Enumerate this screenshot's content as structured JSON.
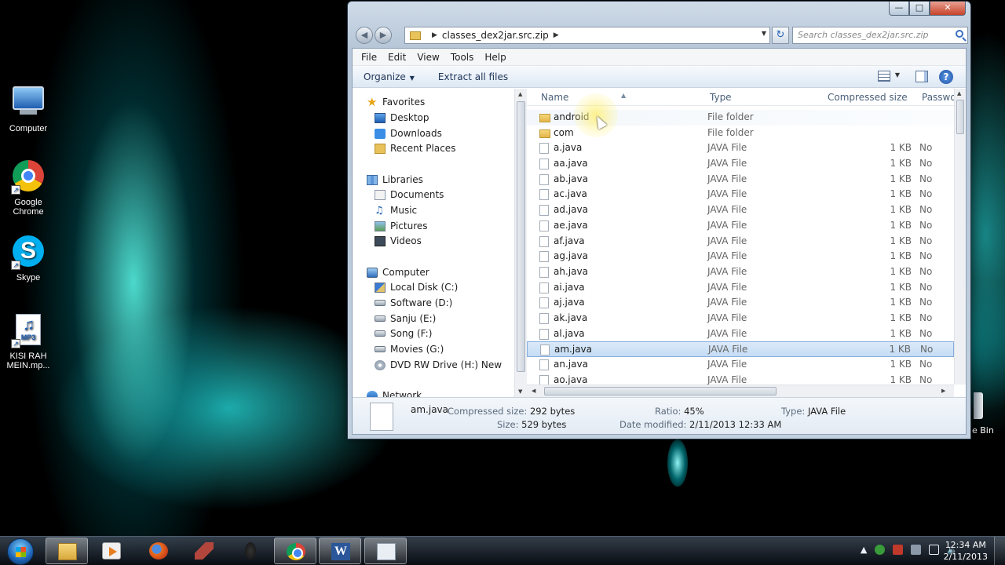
{
  "desktop": {
    "icons": [
      {
        "label": "Computer",
        "icon": "computer-icon"
      },
      {
        "label": "Google Chrome",
        "icon": "chrome-icon"
      },
      {
        "label": "Skype",
        "icon": "skype-icon"
      },
      {
        "label": "KISI RAH MEIN.mp...",
        "icon": "mp3-file-icon",
        "badge": "MP3"
      }
    ],
    "recycle_label": "e Bin"
  },
  "window": {
    "buttons": {
      "minimize": "—",
      "maximize": "□",
      "close": "✕"
    },
    "nav": {
      "back": "◀",
      "forward": "▶"
    },
    "address": {
      "path": "classes_dex2jar.src.zip"
    },
    "search": {
      "placeholder": "Search classes_dex2jar.src.zip"
    },
    "menu": [
      "File",
      "Edit",
      "View",
      "Tools",
      "Help"
    ],
    "commands": {
      "organize": "Organize",
      "extract": "Extract all files"
    },
    "help": "?"
  },
  "nav_pane": {
    "favorites": {
      "label": "Favorites",
      "items": [
        "Desktop",
        "Downloads",
        "Recent Places"
      ]
    },
    "libraries": {
      "label": "Libraries",
      "items": [
        "Documents",
        "Music",
        "Pictures",
        "Videos"
      ]
    },
    "computer": {
      "label": "Computer",
      "items": [
        "Local Disk (C:)",
        "Software (D:)",
        "Sanju (E:)",
        "Song (F:)",
        "Movies (G:)",
        "DVD RW Drive (H:) New"
      ]
    },
    "network": {
      "label": "Network"
    }
  },
  "columns": {
    "name": "Name",
    "type": "Type",
    "compressed_size": "Compressed size",
    "password": "Passwor"
  },
  "files": [
    {
      "name": "android",
      "type": "File folder",
      "size": "",
      "password": "",
      "kind": "folder"
    },
    {
      "name": "com",
      "type": "File folder",
      "size": "",
      "password": "",
      "kind": "folder"
    },
    {
      "name": "a.java",
      "type": "JAVA File",
      "size": "1 KB",
      "password": "No",
      "kind": "file"
    },
    {
      "name": "aa.java",
      "type": "JAVA File",
      "size": "1 KB",
      "password": "No",
      "kind": "file"
    },
    {
      "name": "ab.java",
      "type": "JAVA File",
      "size": "1 KB",
      "password": "No",
      "kind": "file"
    },
    {
      "name": "ac.java",
      "type": "JAVA File",
      "size": "1 KB",
      "password": "No",
      "kind": "file"
    },
    {
      "name": "ad.java",
      "type": "JAVA File",
      "size": "1 KB",
      "password": "No",
      "kind": "file"
    },
    {
      "name": "ae.java",
      "type": "JAVA File",
      "size": "1 KB",
      "password": "No",
      "kind": "file"
    },
    {
      "name": "af.java",
      "type": "JAVA File",
      "size": "1 KB",
      "password": "No",
      "kind": "file"
    },
    {
      "name": "ag.java",
      "type": "JAVA File",
      "size": "1 KB",
      "password": "No",
      "kind": "file"
    },
    {
      "name": "ah.java",
      "type": "JAVA File",
      "size": "1 KB",
      "password": "No",
      "kind": "file"
    },
    {
      "name": "ai.java",
      "type": "JAVA File",
      "size": "1 KB",
      "password": "No",
      "kind": "file"
    },
    {
      "name": "aj.java",
      "type": "JAVA File",
      "size": "1 KB",
      "password": "No",
      "kind": "file"
    },
    {
      "name": "ak.java",
      "type": "JAVA File",
      "size": "1 KB",
      "password": "No",
      "kind": "file"
    },
    {
      "name": "al.java",
      "type": "JAVA File",
      "size": "1 KB",
      "password": "No",
      "kind": "file"
    },
    {
      "name": "am.java",
      "type": "JAVA File",
      "size": "1 KB",
      "password": "No",
      "kind": "file",
      "selected": true
    },
    {
      "name": "an.java",
      "type": "JAVA File",
      "size": "1 KB",
      "password": "No",
      "kind": "file"
    },
    {
      "name": "ao.java",
      "type": "JAVA File",
      "size": "1 KB",
      "password": "No",
      "kind": "file"
    }
  ],
  "details": {
    "name": "am.java",
    "compressed_size_label": "Compressed size:",
    "compressed_size": "292 bytes",
    "size_label": "Size:",
    "size": "529 bytes",
    "ratio_label": "Ratio:",
    "ratio": "45%",
    "date_label": "Date modified:",
    "date": "2/11/2013 12:33 AM",
    "type_label": "Type:",
    "type": "JAVA File"
  },
  "taskbar": {
    "apps": [
      "windows-explorer",
      "media-player",
      "firefox",
      "game",
      "unknown",
      "chrome",
      "word",
      "app-window"
    ],
    "active_app": "app-window",
    "word_letter": "W",
    "clock": {
      "time": "12:34 AM",
      "date": "2/11/2013"
    }
  }
}
